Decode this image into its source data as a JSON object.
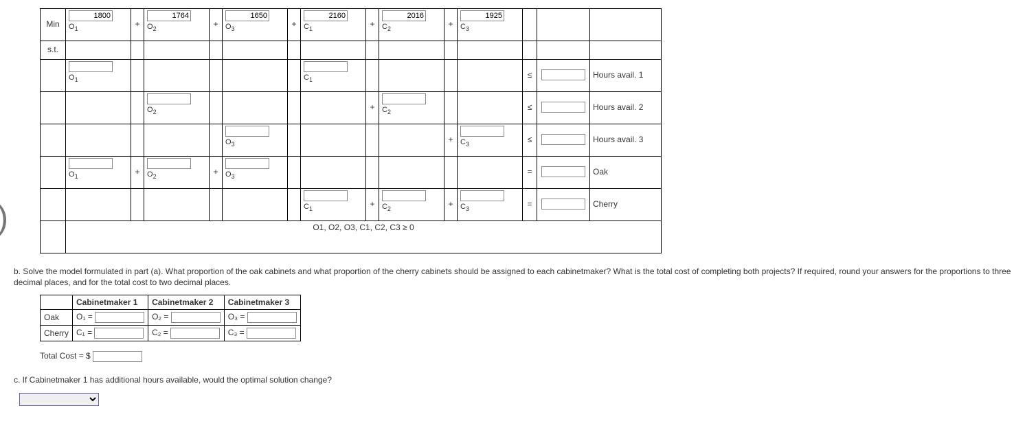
{
  "lp": {
    "row_labels": {
      "min": "Min",
      "st": "s.t."
    },
    "vars": {
      "o1": "O",
      "o2": "O",
      "o3": "O",
      "c1": "C",
      "c2": "C",
      "c3": "C"
    },
    "subs": {
      "o1": "1",
      "o2": "2",
      "o3": "3",
      "c1": "1",
      "c2": "2",
      "c3": "3"
    },
    "obj_coef": {
      "o1": "1800",
      "o2": "1764",
      "o3": "1650",
      "c1": "2160",
      "c2": "2016",
      "c3": "1925"
    },
    "plus": "+",
    "le": "≤",
    "eq": "=",
    "rhs_labels": {
      "h1": "Hours avail. 1",
      "h2": "Hours avail. 2",
      "h3": "Hours avail. 3",
      "oak": "Oak",
      "cherry": "Cherry"
    },
    "nonneg": "O1, O2, O3, C1, C2, C3 ≥ 0"
  },
  "partb_text": "b. Solve the model formulated in part (a). What proportion of the oak cabinets and what proportion of the cherry cabinets should be assigned to each cabinetmaker? What is the total cost of completing both projects? If required, round your answers for the proportions to three decimal places, and for the total cost to two decimal places.",
  "ans_table": {
    "headers": {
      "c1": "Cabinetmaker 1",
      "c2": "Cabinetmaker 2",
      "c3": "Cabinetmaker 3"
    },
    "rows": {
      "oak": "Oak",
      "cherry": "Cherry"
    },
    "cell_labels": {
      "oak": {
        "c1": "O₁ =",
        "c2": "O₂ =",
        "c3": "O₃ ="
      },
      "cherry": {
        "c1": "C₁ =",
        "c2": "C₂ =",
        "c3": "C₃ ="
      }
    }
  },
  "total_cost_label": "Total Cost = $",
  "partc_text": "c. If Cabinetmaker 1 has additional hours available, would the optimal solution change?"
}
